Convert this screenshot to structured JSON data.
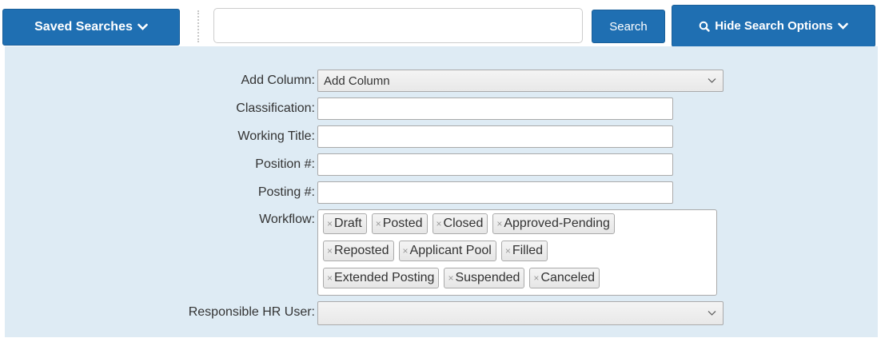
{
  "toolbar": {
    "saved_searches_label": "Saved Searches",
    "search_placeholder": "",
    "search_value": "",
    "search_button_label": "Search",
    "hide_options_label": "Hide Search Options"
  },
  "form": {
    "add_column": {
      "label": "Add Column:",
      "value": "Add Column"
    },
    "classification": {
      "label": "Classification:",
      "value": ""
    },
    "working_title": {
      "label": "Working Title:",
      "value": ""
    },
    "position_no": {
      "label": "Position #:",
      "value": ""
    },
    "posting_no": {
      "label": "Posting #:",
      "value": ""
    },
    "workflow": {
      "label": "Workflow:",
      "tags": [
        "Draft",
        "Posted",
        "Closed",
        "Approved-Pending",
        "Reposted",
        "Applicant Pool",
        "Filled",
        "Extended Posting",
        "Suspended",
        "Canceled"
      ]
    },
    "responsible_hr_user": {
      "label": "Responsible HR User:",
      "value": ""
    }
  },
  "colors": {
    "primary_button": "#1f6fb2",
    "panel_background": "#deebf4"
  },
  "icons": {
    "chevron": "chevron-down-icon",
    "search": "search-icon",
    "tag_remove": "close-icon"
  }
}
